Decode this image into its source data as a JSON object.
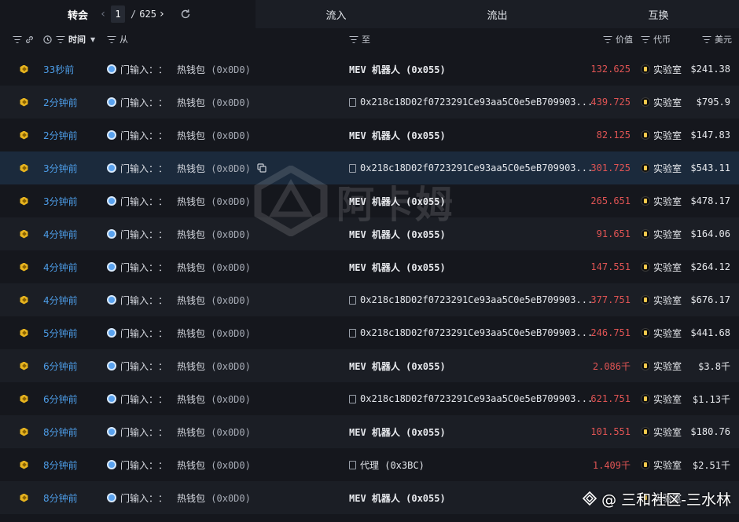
{
  "topbar": {
    "transfers_label": "转会",
    "page_current": "1",
    "page_separator": "/",
    "page_total": "625",
    "tabs": [
      "流入",
      "流出",
      "互换"
    ]
  },
  "header": {
    "time": "时间",
    "from": "从",
    "to": "至",
    "value": "价值",
    "token": "代币",
    "usd": "美元"
  },
  "rows": [
    {
      "time": "33秒前",
      "from_label": "门输入：",
      "from_sep": "：",
      "from_wallet": "热钱包",
      "from_addr": "(0x0D0)",
      "to": "MEV 机器人 (0x055)",
      "to_is_address": false,
      "value": "132.625",
      "token": "实验室",
      "usd": "$241.38"
    },
    {
      "time": "2分钟前",
      "from_label": "门输入：",
      "from_sep": "：",
      "from_wallet": "热钱包",
      "from_addr": "(0x0D0)",
      "to": "0x218c18D02f0723291Ce93aa5C0e5eB709903...",
      "to_is_address": true,
      "value": "439.725",
      "token": "实验室",
      "usd": "$795.9"
    },
    {
      "time": "2分钟前",
      "from_label": "门输入：",
      "from_sep": "：",
      "from_wallet": "热钱包",
      "from_addr": "(0x0D0)",
      "to": "MEV 机器人 (0x055)",
      "to_is_address": false,
      "value": "82.125",
      "token": "实验室",
      "usd": "$147.83"
    },
    {
      "time": "3分钟前",
      "from_label": "门输入：",
      "from_sep": "：",
      "from_wallet": "热钱包",
      "from_addr": "(0x0D0)",
      "to": "0x218c18D02f0723291Ce93aa5C0e5eB709903...",
      "to_is_address": true,
      "value": "301.725",
      "token": "实验室",
      "usd": "$543.11"
    },
    {
      "time": "3分钟前",
      "from_label": "门输入：",
      "from_sep": "：",
      "from_wallet": "热钱包",
      "from_addr": "(0x0D0)",
      "to": "MEV 机器人 (0x055)",
      "to_is_address": false,
      "value": "265.651",
      "token": "实验室",
      "usd": "$478.17"
    },
    {
      "time": "4分钟前",
      "from_label": "门输入：",
      "from_sep": "：",
      "from_wallet": "热钱包",
      "from_addr": "(0x0D0)",
      "to": "MEV 机器人 (0x055)",
      "to_is_address": false,
      "value": "91.651",
      "token": "实验室",
      "usd": "$164.06"
    },
    {
      "time": "4分钟前",
      "from_label": "门输入：",
      "from_sep": "：",
      "from_wallet": "热钱包",
      "from_addr": "(0x0D0)",
      "to": "MEV 机器人 (0x055)",
      "to_is_address": false,
      "value": "147.551",
      "token": "实验室",
      "usd": "$264.12"
    },
    {
      "time": "4分钟前",
      "from_label": "门输入：",
      "from_sep": "：",
      "from_wallet": "热钱包",
      "from_addr": "(0x0D0)",
      "to": "0x218c18D02f0723291Ce93aa5C0e5eB709903...",
      "to_is_address": true,
      "value": "377.751",
      "token": "实验室",
      "usd": "$676.17"
    },
    {
      "time": "5分钟前",
      "from_label": "门输入：",
      "from_sep": "：",
      "from_wallet": "热钱包",
      "from_addr": "(0x0D0)",
      "to": "0x218c18D02f0723291Ce93aa5C0e5eB709903...",
      "to_is_address": true,
      "value": "246.751",
      "token": "实验室",
      "usd": "$441.68"
    },
    {
      "time": "6分钟前",
      "from_label": "门输入：",
      "from_sep": "：",
      "from_wallet": "热钱包",
      "from_addr": "(0x0D0)",
      "to": "MEV 机器人 (0x055)",
      "to_is_address": false,
      "value": "2.086千",
      "token": "实验室",
      "usd": "$3.8千"
    },
    {
      "time": "6分钟前",
      "from_label": "门输入：",
      "from_sep": "：",
      "from_wallet": "热钱包",
      "from_addr": "(0x0D0)",
      "to": "0x218c18D02f0723291Ce93aa5C0e5eB709903...",
      "to_is_address": true,
      "value": "621.751",
      "token": "实验室",
      "usd": "$1.13千"
    },
    {
      "time": "8分钟前",
      "from_label": "门输入：",
      "from_sep": "：",
      "from_wallet": "热钱包",
      "from_addr": "(0x0D0)",
      "to": "MEV 机器人 (0x055)",
      "to_is_address": false,
      "value": "101.551",
      "token": "实验室",
      "usd": "$180.76"
    },
    {
      "time": "8分钟前",
      "from_label": "门输入：",
      "from_sep": "：",
      "from_wallet": "热钱包",
      "from_addr": "(0x0D0)",
      "to": "代理 (0x3BC)",
      "to_is_address": true,
      "value": "1.409千",
      "token": "实验室",
      "usd": "$2.51千"
    },
    {
      "time": "8分钟前",
      "from_label": "门输入：",
      "from_sep": "：",
      "from_wallet": "热钱包",
      "from_addr": "(0x0D0)",
      "to": "MEV 机器人 (0x055)",
      "to_is_address": false,
      "value": "",
      "token": "实验室",
      "usd": ""
    }
  ],
  "watermark": {
    "text": "阿卡姆"
  },
  "footer_mark": {
    "text": "@ 三和社区-三水林"
  },
  "colors": {
    "background": "#15171d",
    "time_link": "#4d9de8",
    "value_negative": "#e05454",
    "selected_row": "#1b2a3c"
  }
}
